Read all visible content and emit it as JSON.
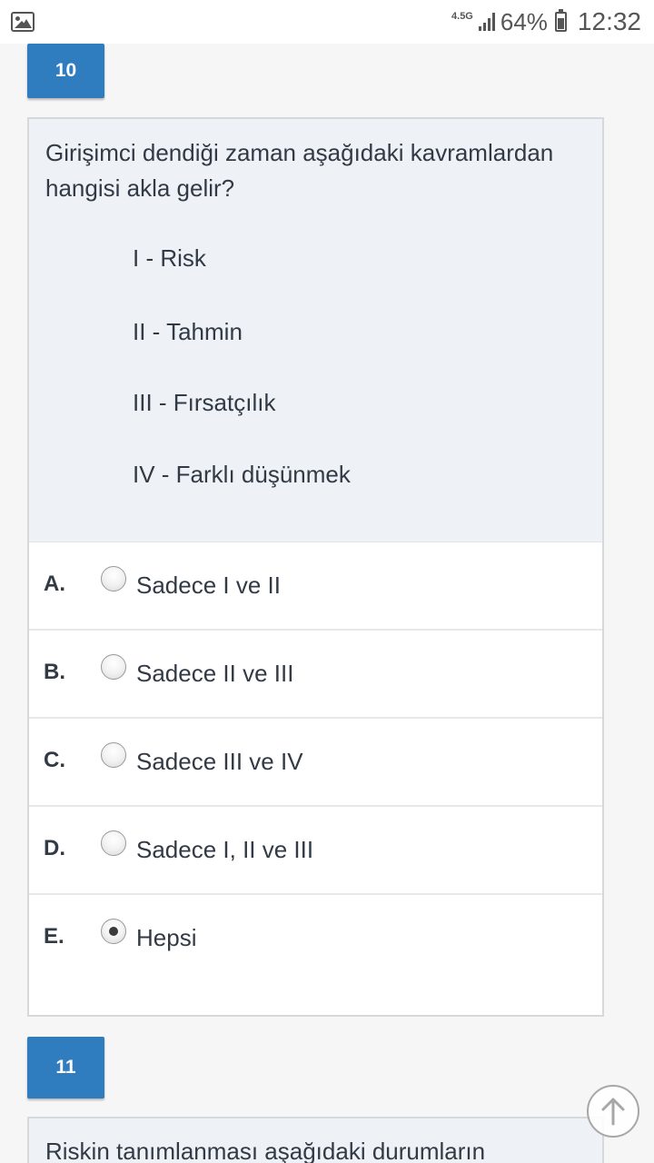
{
  "status_bar": {
    "network": "4.5G",
    "battery": "64%",
    "time": "12:32"
  },
  "question10": {
    "number": "10",
    "stem": "Girişimci dendiği zaman aşağıdaki kavramlardan hangisi akla gelir?",
    "items": [
      "I - Risk",
      "II - Tahmin",
      "III - Fırsatçılık",
      "IV - Farklı düşünmek"
    ],
    "options": [
      {
        "letter": "A.",
        "text": "Sadece I ve II",
        "selected": false
      },
      {
        "letter": "B.",
        "text": "Sadece II ve III",
        "selected": false
      },
      {
        "letter": "C.",
        "text": "Sadece III ve IV",
        "selected": false
      },
      {
        "letter": "D.",
        "text": "Sadece I, II ve III",
        "selected": false
      },
      {
        "letter": "E.",
        "text": "Hepsi",
        "selected": true
      }
    ]
  },
  "question11": {
    "number": "11",
    "stem": "Riskin tanımlanması aşağıdaki durumların"
  },
  "icons": {
    "gallery": "image-icon",
    "scroll_top": "arrow-up-circle-icon"
  }
}
